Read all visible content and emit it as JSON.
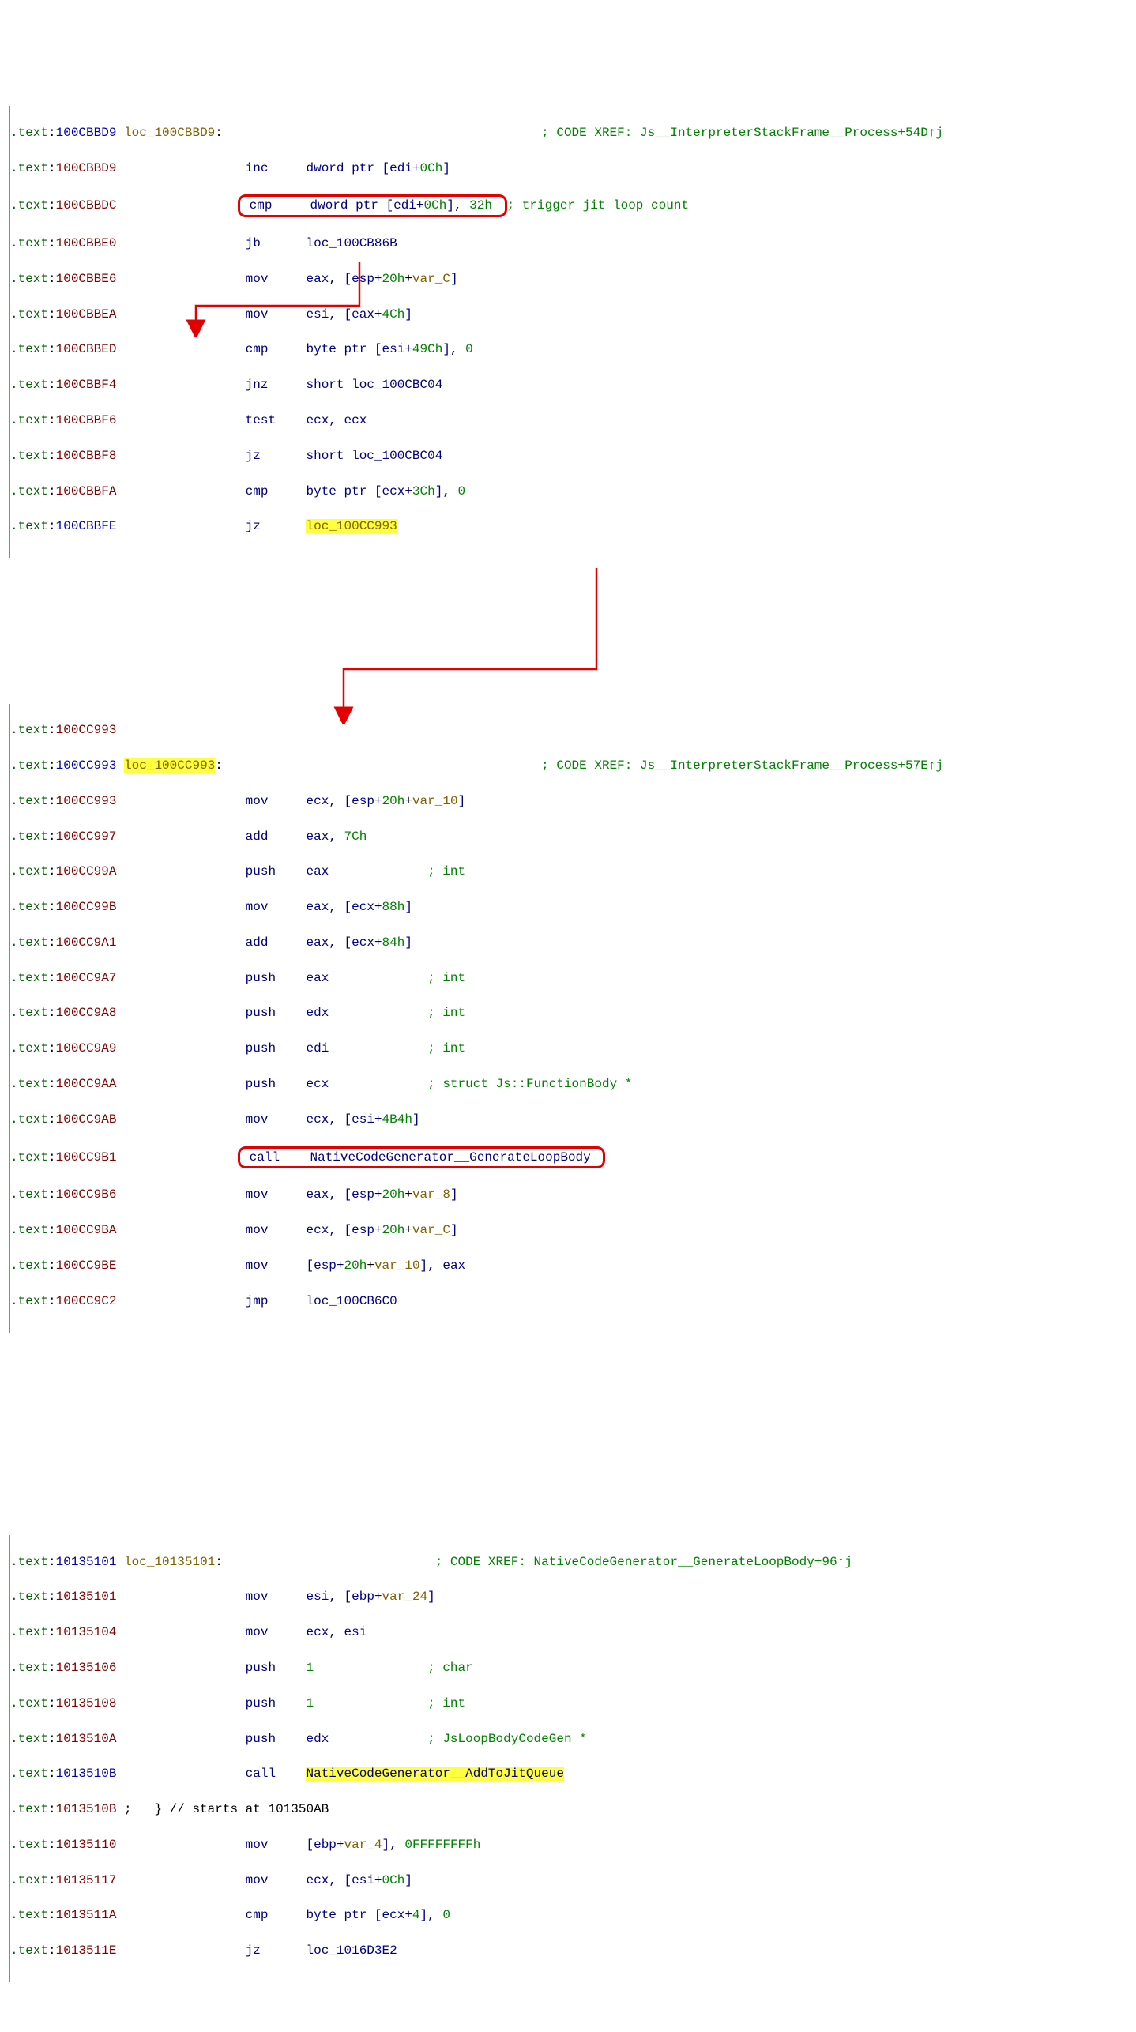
{
  "block1": {
    "label_addr": "100CBBD9",
    "label_name": "loc_100CBBD9",
    "xref1": "; CODE XREF: Js__InterpreterStackFrame__Process+54D↑j",
    "lines": [
      {
        "addr": "100CBBD9",
        "mnem": "inc",
        "ops": "dword ptr [edi+",
        "ops2": "0Ch",
        "ops3": "]",
        "cls": "plain"
      },
      {
        "addr": "100CBBDC",
        "mnem": "cmp",
        "ops": "dword ptr [edi+",
        "ops2": "0Ch",
        "ops3": "], ",
        "val": "32h",
        "cmt": "; trigger jit loop count",
        "boxed": true
      },
      {
        "addr": "100CBBE0",
        "mnem": "jb",
        "tgt": "loc_100CB86B"
      },
      {
        "addr": "100CBBE6",
        "mnem": "mov",
        "r1": "eax",
        "mem": ", [esp+",
        "n1": "20h",
        "mid": "+",
        "v": "var_C",
        "end": "]"
      },
      {
        "addr": "100CBBEA",
        "mnem": "mov",
        "r1": "esi",
        "mem": ", [eax+",
        "n1": "4Ch",
        "end": "]"
      },
      {
        "addr": "100CBBED",
        "mnem": "cmp",
        "ops": "byte ptr [esi+",
        "n1": "49Ch",
        "end": "], ",
        "val": "0"
      },
      {
        "addr": "100CBBF4",
        "mnem": "jnz",
        "tgt": "short loc_100CBC04"
      },
      {
        "addr": "100CBBF6",
        "mnem": "test",
        "r1": "ecx",
        "r2": ", ecx"
      },
      {
        "addr": "100CBBF8",
        "mnem": "jz",
        "tgt": "short loc_100CBC04"
      },
      {
        "addr": "100CBBFA",
        "mnem": "cmp",
        "ops": "byte ptr [ecx+",
        "n1": "3Ch",
        "end": "], ",
        "val": "0"
      },
      {
        "addr": "100CBBFE",
        "mnem": "jz",
        "tgt": "loc_100CC993",
        "hl": true,
        "hot": true
      }
    ]
  },
  "block2": {
    "pre_addr": "100CC993",
    "label_addr": "100CC993",
    "label_name": "loc_100CC993",
    "xref": "; CODE XREF: Js__InterpreterStackFrame__Process+57E↑j",
    "lines": [
      {
        "addr": "100CC993",
        "mnem": "mov",
        "r1": "ecx",
        "mem": ", [esp+",
        "n1": "20h",
        "mid": "+",
        "v": "var_10",
        "end": "]"
      },
      {
        "addr": "100CC997",
        "mnem": "add",
        "r1": "eax",
        "r2": ", ",
        "val": "7Ch"
      },
      {
        "addr": "100CC99A",
        "mnem": "push",
        "r1": "eax",
        "cmt": "; int"
      },
      {
        "addr": "100CC99B",
        "mnem": "mov",
        "r1": "eax",
        "mem": ", [ecx+",
        "n1": "88h",
        "end": "]"
      },
      {
        "addr": "100CC9A1",
        "mnem": "add",
        "r1": "eax",
        "mem": ", [ecx+",
        "n1": "84h",
        "end": "]"
      },
      {
        "addr": "100CC9A7",
        "mnem": "push",
        "r1": "eax",
        "cmt": "; int"
      },
      {
        "addr": "100CC9A8",
        "mnem": "push",
        "r1": "edx",
        "cmt": "; int"
      },
      {
        "addr": "100CC9A9",
        "mnem": "push",
        "r1": "edi",
        "cmt": "; int"
      },
      {
        "addr": "100CC9AA",
        "mnem": "push",
        "r1": "ecx",
        "cmt": "; struct Js::FunctionBody *"
      },
      {
        "addr": "100CC9AB",
        "mnem": "mov",
        "r1": "ecx",
        "mem": ", [esi+",
        "n1": "4B4h",
        "end": "]"
      },
      {
        "addr": "100CC9B1",
        "mnem": "call",
        "sym": "NativeCodeGenerator__GenerateLoopBody",
        "boxed": true
      },
      {
        "addr": "100CC9B6",
        "mnem": "mov",
        "r1": "eax",
        "mem": ", [esp+",
        "n1": "20h",
        "mid": "+",
        "v": "var_8",
        "end": "]"
      },
      {
        "addr": "100CC9BA",
        "mnem": "mov",
        "r1": "ecx",
        "mem": ", [esp+",
        "n1": "20h",
        "mid": "+",
        "v": "var_C",
        "end": "]"
      },
      {
        "addr": "100CC9BE",
        "mnem": "mov",
        "mem": "[esp+",
        "n1": "20h",
        "mid": "+",
        "v": "var_10",
        "end": "], eax"
      },
      {
        "addr": "100CC9C2",
        "mnem": "jmp",
        "tgt": "loc_100CB6C0"
      }
    ]
  },
  "block3": {
    "label_addr": "10135101",
    "label_name": "loc_10135101",
    "xref": "; CODE XREF: NativeCodeGenerator__GenerateLoopBody+96↑j",
    "lines": [
      {
        "addr": "10135101",
        "mnem": "mov",
        "r1": "esi",
        "mem": ", [ebp+",
        "v": "var_24",
        "end": "]"
      },
      {
        "addr": "10135104",
        "mnem": "mov",
        "r1": "ecx",
        "r2": ", esi"
      },
      {
        "addr": "10135106",
        "mnem": "push",
        "val": "1",
        "cmt": "; char"
      },
      {
        "addr": "10135108",
        "mnem": "push",
        "val": "1",
        "cmt": "; int"
      },
      {
        "addr": "1013510A",
        "mnem": "push",
        "r1": "edx",
        "cmt": "; JsLoopBodyCodeGen *"
      },
      {
        "addr": "1013510B",
        "mnem": "call",
        "sym": "NativeCodeGenerator__AddToJitQueue",
        "hl": true,
        "hot": true
      },
      {
        "addr": "1013510B",
        "extra": " ;   } // starts at 101350AB"
      },
      {
        "addr": "10135110",
        "mnem": "mov",
        "mem": "[ebp+",
        "v": "var_4",
        "end": "], ",
        "val": "0FFFFFFFFh"
      },
      {
        "addr": "10135117",
        "mnem": "mov",
        "r1": "ecx",
        "mem": ", [esi+",
        "n1": "0Ch",
        "end": "]"
      },
      {
        "addr": "1013511A",
        "mnem": "cmp",
        "ops": "byte ptr [ecx+",
        "n1": "4",
        "end": "], ",
        "val": "0"
      },
      {
        "addr": "1013511E",
        "mnem": "jz",
        "tgt": "loc_1016D3E2"
      }
    ]
  }
}
